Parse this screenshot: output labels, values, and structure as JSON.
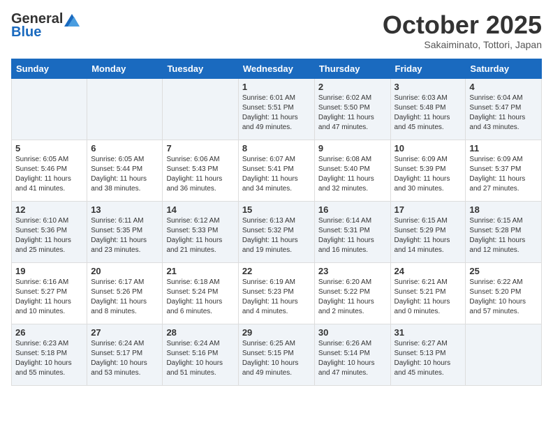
{
  "header": {
    "logo_general": "General",
    "logo_blue": "Blue",
    "month": "October 2025",
    "location": "Sakaiminato, Tottori, Japan"
  },
  "weekdays": [
    "Sunday",
    "Monday",
    "Tuesday",
    "Wednesday",
    "Thursday",
    "Friday",
    "Saturday"
  ],
  "weeks": [
    [
      {
        "day": "",
        "info": ""
      },
      {
        "day": "",
        "info": ""
      },
      {
        "day": "",
        "info": ""
      },
      {
        "day": "1",
        "info": "Sunrise: 6:01 AM\nSunset: 5:51 PM\nDaylight: 11 hours\nand 49 minutes."
      },
      {
        "day": "2",
        "info": "Sunrise: 6:02 AM\nSunset: 5:50 PM\nDaylight: 11 hours\nand 47 minutes."
      },
      {
        "day": "3",
        "info": "Sunrise: 6:03 AM\nSunset: 5:48 PM\nDaylight: 11 hours\nand 45 minutes."
      },
      {
        "day": "4",
        "info": "Sunrise: 6:04 AM\nSunset: 5:47 PM\nDaylight: 11 hours\nand 43 minutes."
      }
    ],
    [
      {
        "day": "5",
        "info": "Sunrise: 6:05 AM\nSunset: 5:46 PM\nDaylight: 11 hours\nand 41 minutes."
      },
      {
        "day": "6",
        "info": "Sunrise: 6:05 AM\nSunset: 5:44 PM\nDaylight: 11 hours\nand 38 minutes."
      },
      {
        "day": "7",
        "info": "Sunrise: 6:06 AM\nSunset: 5:43 PM\nDaylight: 11 hours\nand 36 minutes."
      },
      {
        "day": "8",
        "info": "Sunrise: 6:07 AM\nSunset: 5:41 PM\nDaylight: 11 hours\nand 34 minutes."
      },
      {
        "day": "9",
        "info": "Sunrise: 6:08 AM\nSunset: 5:40 PM\nDaylight: 11 hours\nand 32 minutes."
      },
      {
        "day": "10",
        "info": "Sunrise: 6:09 AM\nSunset: 5:39 PM\nDaylight: 11 hours\nand 30 minutes."
      },
      {
        "day": "11",
        "info": "Sunrise: 6:09 AM\nSunset: 5:37 PM\nDaylight: 11 hours\nand 27 minutes."
      }
    ],
    [
      {
        "day": "12",
        "info": "Sunrise: 6:10 AM\nSunset: 5:36 PM\nDaylight: 11 hours\nand 25 minutes."
      },
      {
        "day": "13",
        "info": "Sunrise: 6:11 AM\nSunset: 5:35 PM\nDaylight: 11 hours\nand 23 minutes."
      },
      {
        "day": "14",
        "info": "Sunrise: 6:12 AM\nSunset: 5:33 PM\nDaylight: 11 hours\nand 21 minutes."
      },
      {
        "day": "15",
        "info": "Sunrise: 6:13 AM\nSunset: 5:32 PM\nDaylight: 11 hours\nand 19 minutes."
      },
      {
        "day": "16",
        "info": "Sunrise: 6:14 AM\nSunset: 5:31 PM\nDaylight: 11 hours\nand 16 minutes."
      },
      {
        "day": "17",
        "info": "Sunrise: 6:15 AM\nSunset: 5:29 PM\nDaylight: 11 hours\nand 14 minutes."
      },
      {
        "day": "18",
        "info": "Sunrise: 6:15 AM\nSunset: 5:28 PM\nDaylight: 11 hours\nand 12 minutes."
      }
    ],
    [
      {
        "day": "19",
        "info": "Sunrise: 6:16 AM\nSunset: 5:27 PM\nDaylight: 11 hours\nand 10 minutes."
      },
      {
        "day": "20",
        "info": "Sunrise: 6:17 AM\nSunset: 5:26 PM\nDaylight: 11 hours\nand 8 minutes."
      },
      {
        "day": "21",
        "info": "Sunrise: 6:18 AM\nSunset: 5:24 PM\nDaylight: 11 hours\nand 6 minutes."
      },
      {
        "day": "22",
        "info": "Sunrise: 6:19 AM\nSunset: 5:23 PM\nDaylight: 11 hours\nand 4 minutes."
      },
      {
        "day": "23",
        "info": "Sunrise: 6:20 AM\nSunset: 5:22 PM\nDaylight: 11 hours\nand 2 minutes."
      },
      {
        "day": "24",
        "info": "Sunrise: 6:21 AM\nSunset: 5:21 PM\nDaylight: 11 hours\nand 0 minutes."
      },
      {
        "day": "25",
        "info": "Sunrise: 6:22 AM\nSunset: 5:20 PM\nDaylight: 10 hours\nand 57 minutes."
      }
    ],
    [
      {
        "day": "26",
        "info": "Sunrise: 6:23 AM\nSunset: 5:18 PM\nDaylight: 10 hours\nand 55 minutes."
      },
      {
        "day": "27",
        "info": "Sunrise: 6:24 AM\nSunset: 5:17 PM\nDaylight: 10 hours\nand 53 minutes."
      },
      {
        "day": "28",
        "info": "Sunrise: 6:24 AM\nSunset: 5:16 PM\nDaylight: 10 hours\nand 51 minutes."
      },
      {
        "day": "29",
        "info": "Sunrise: 6:25 AM\nSunset: 5:15 PM\nDaylight: 10 hours\nand 49 minutes."
      },
      {
        "day": "30",
        "info": "Sunrise: 6:26 AM\nSunset: 5:14 PM\nDaylight: 10 hours\nand 47 minutes."
      },
      {
        "day": "31",
        "info": "Sunrise: 6:27 AM\nSunset: 5:13 PM\nDaylight: 10 hours\nand 45 minutes."
      },
      {
        "day": "",
        "info": ""
      }
    ]
  ]
}
